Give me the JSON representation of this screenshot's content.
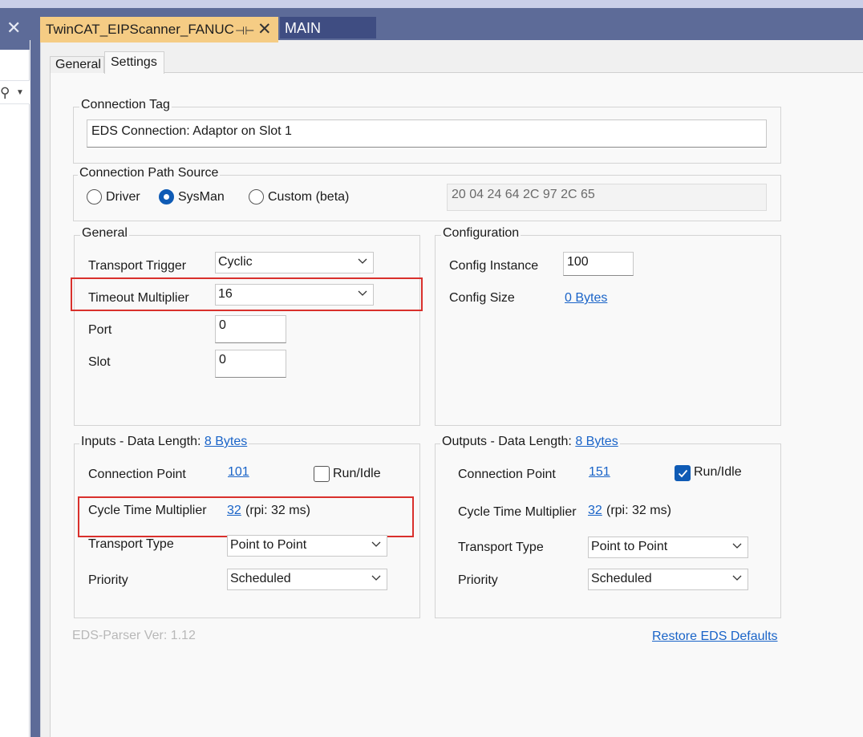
{
  "window": {
    "doc_tabs": [
      {
        "label": "TwinCAT_EIPScanner_FANUC"
      },
      {
        "label": "MAIN"
      }
    ]
  },
  "inner_tabs": [
    "General",
    "Settings"
  ],
  "connection_tag": {
    "legend": "Connection Tag",
    "value": "EDS Connection: Adaptor on Slot 1"
  },
  "path_source": {
    "legend": "Connection Path Source",
    "options": [
      "Driver",
      "SysMan",
      "Custom (beta)"
    ],
    "selected": "SysMan",
    "path_value": "20 04 24 64 2C 97 2C 65"
  },
  "general": {
    "legend": "General",
    "transport_trigger_label": "Transport Trigger",
    "transport_trigger_value": "Cyclic",
    "timeout_multiplier_label": "Timeout Multiplier",
    "timeout_multiplier_value": "16",
    "port_label": "Port",
    "port_value": "0",
    "slot_label": "Slot",
    "slot_value": "0"
  },
  "configuration": {
    "legend": "Configuration",
    "config_instance_label": "Config Instance",
    "config_instance_value": "100",
    "config_size_label": "Config Size",
    "config_size_value": "0 Bytes"
  },
  "inputs": {
    "legend_prefix": "Inputs - Data Length: ",
    "legend_link": "8 Bytes",
    "connection_point_label": "Connection Point",
    "connection_point_value": "101",
    "run_idle_label": "Run/Idle",
    "run_idle_checked": false,
    "cycle_time_label": "Cycle Time Multiplier",
    "cycle_time_value": "32",
    "cycle_time_rpi": "(rpi: 32 ms)",
    "transport_type_label": "Transport Type",
    "transport_type_value": "Point to Point",
    "priority_label": "Priority",
    "priority_value": "Scheduled"
  },
  "outputs": {
    "legend_prefix": "Outputs - Data Length: ",
    "legend_link": "8 Bytes",
    "connection_point_label": "Connection Point",
    "connection_point_value": "151",
    "run_idle_label": "Run/Idle",
    "run_idle_checked": true,
    "cycle_time_label": "Cycle Time Multiplier",
    "cycle_time_value": "32",
    "cycle_time_rpi": "(rpi: 32 ms)",
    "transport_type_label": "Transport Type",
    "transport_type_value": "Point to Point",
    "priority_label": "Priority",
    "priority_value": "Scheduled"
  },
  "footer": {
    "eds_parser_version": "EDS-Parser Ver: 1.12",
    "restore_defaults": "Restore EDS Defaults"
  },
  "colors": {
    "accent": "#0f5bb5",
    "link": "#1a64c8",
    "highlight": "#d9302c",
    "title_bar": "#5d6b98",
    "active_doc_tab": "#f5cc84"
  },
  "icons": {
    "left_close": "close-icon",
    "left_search": "search-icon",
    "doc_pin": "pin-icon",
    "doc_close": "close-icon",
    "combo": "chevron-down-icon"
  }
}
